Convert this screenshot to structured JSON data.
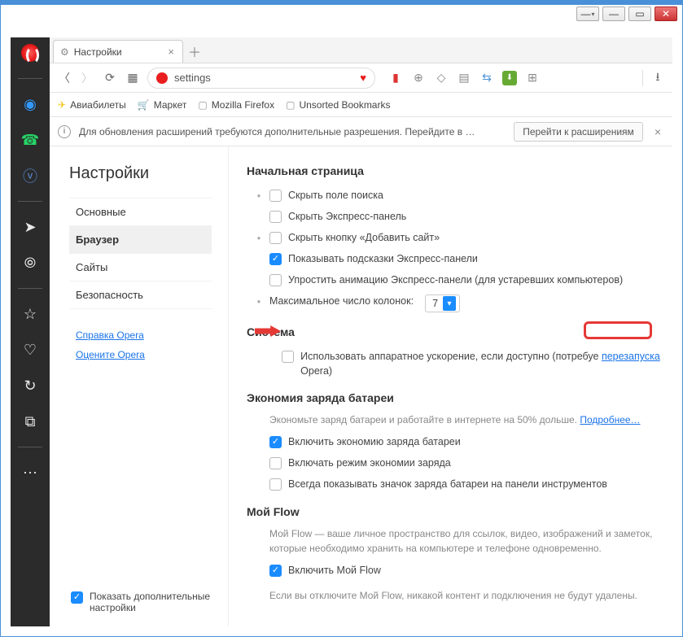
{
  "window": {
    "title": "Настройки"
  },
  "tab": {
    "title": "Настройки"
  },
  "address": {
    "text": "settings"
  },
  "bookmarks": {
    "b1": "Авиабилеты",
    "b2": "Маркет",
    "b3": "Mozilla Firefox",
    "b4": "Unsorted Bookmarks"
  },
  "infobar": {
    "msg": "Для обновления расширений требуются дополнительные разрешения. Перейдите в …",
    "btn": "Перейти к расширениям"
  },
  "sidebar": {
    "heading": "Настройки",
    "nav": {
      "basic": "Основные",
      "browser": "Браузер",
      "sites": "Сайты",
      "security": "Безопасность"
    },
    "links": {
      "help": "Справка Opera",
      "rate": "Оцените Opera"
    },
    "advanced": "Показать дополнительные настройки"
  },
  "content": {
    "startpage": {
      "title": "Начальная страница",
      "o1": "Скрыть поле поиска",
      "o2": "Скрыть Экспресс-панель",
      "o3": "Скрыть кнопку «Добавить сайт»",
      "o4": "Показывать подсказки Экспресс-панели",
      "o5": "Упростить анимацию Экспресс-панели (для устаревших компьютеров)",
      "o6_label": "Максимальное число колонок:",
      "o6_value": "7"
    },
    "system": {
      "title": "Система",
      "hw_pre": "Использовать аппаратное ускорение, если доступно (потребуе",
      "hw_link": "перезапуска",
      "hw_post": " Opera)"
    },
    "battery": {
      "title": "Экономия заряда батареи",
      "desc_pre": "Экономьте заряд батареи и работайте в интернете на 50% дольше. ",
      "desc_link": "Подробнее…",
      "o1": "Включить экономию заряда батареи",
      "o2": "Включать режим экономии заряда",
      "o3": "Всегда показывать значок заряда батареи на панели инструментов"
    },
    "flow": {
      "title": "Мой Flow",
      "desc": "Мой Flow — ваше личное пространство для ссылок, видео, изображений и заметок, которые необходимо хранить на компьютере и телефоне одновременно.",
      "o1": "Включить Мой Flow",
      "note": "Если вы отключите Мой Flow, никакой контент и подключения не будут удалены."
    }
  }
}
